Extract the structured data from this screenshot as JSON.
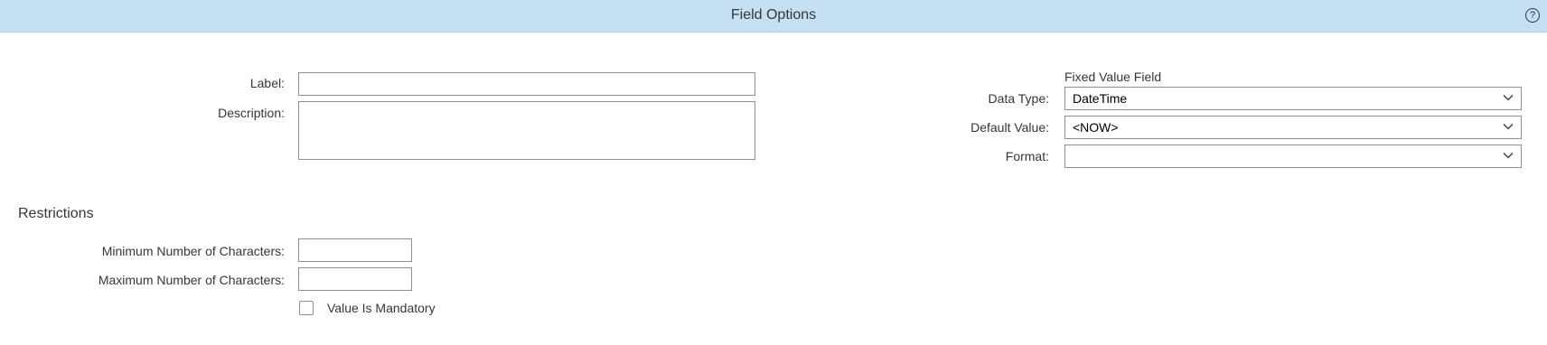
{
  "dialog": {
    "title": "Field Options",
    "help_icon": "question-circle-icon"
  },
  "general": {
    "label": {
      "label": "Label:",
      "value": ""
    },
    "description": {
      "label": "Description:",
      "value": ""
    }
  },
  "fixed_value": {
    "heading": "Fixed Value Field",
    "data_type": {
      "label": "Data Type:",
      "value": "DateTime"
    },
    "default_value": {
      "label": "Default Value:",
      "value": "<NOW>"
    },
    "format": {
      "label": "Format:",
      "value": ""
    }
  },
  "restrictions": {
    "title": "Restrictions",
    "min_chars": {
      "label": "Minimum Number of Characters:",
      "value": ""
    },
    "max_chars": {
      "label": "Maximum Number of Characters:",
      "value": ""
    },
    "mandatory": {
      "label": "Value Is Mandatory",
      "checked": false
    }
  },
  "colors": {
    "header_bg": "#c5dff3",
    "border": "#89919a",
    "text": "#32363a"
  }
}
